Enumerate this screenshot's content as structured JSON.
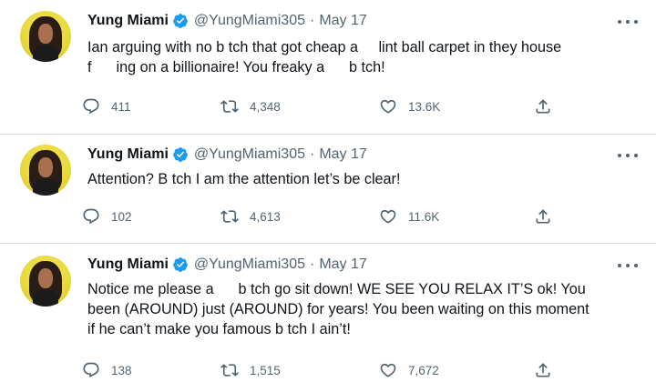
{
  "tweets": [
    {
      "name": "Yung Miami",
      "handle": "@YungMiami305",
      "separator": "·",
      "date": "May 17",
      "text_lines": [
        "Ian arguing with no b tch that got cheap a     lint ball carpet in they house",
        "f      ing on a billionaire! You freaky a      b tch!"
      ],
      "replies": "411",
      "retweets": "4,348",
      "likes": "13.6K"
    },
    {
      "name": "Yung Miami",
      "handle": "@YungMiami305",
      "separator": "·",
      "date": "May 17",
      "text_lines": [
        "Attention? B tch I am the attention let’s be clear!"
      ],
      "replies": "102",
      "retweets": "4,613",
      "likes": "11.6K"
    },
    {
      "name": "Yung Miami",
      "handle": "@YungMiami305",
      "separator": "·",
      "date": "May 17",
      "text_lines": [
        "Notice me please a      b tch go sit down! WE SEE YOU RELAX IT’S ok! You",
        "been (AROUND) just (AROUND) for years! You been waiting on this moment",
        "if he can’t make you famous b tch I ain’t!"
      ],
      "replies": "138",
      "retweets": "1,515",
      "likes": "7,672"
    }
  ],
  "icons": {
    "verified": "verified-badge-icon",
    "more": "more-options-icon",
    "reply": "reply-icon",
    "retweet": "retweet-icon",
    "like": "heart-icon",
    "share": "share-icon"
  },
  "colors": {
    "verified_blue": "#1d9bf0",
    "secondary_text": "#536471",
    "avatar_bg": "#e9d93e"
  }
}
